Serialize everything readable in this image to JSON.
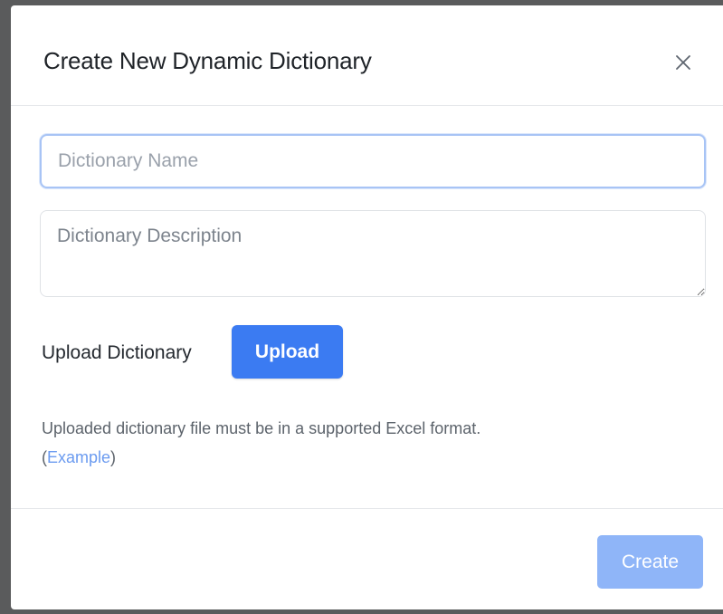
{
  "dialog": {
    "title": "Create New Dynamic Dictionary",
    "close_icon": "close-icon"
  },
  "form": {
    "name_placeholder": "Dictionary Name",
    "name_value": "",
    "description_placeholder": "Dictionary Description",
    "description_value": "",
    "upload_label": "Upload Dictionary",
    "upload_button_label": "Upload",
    "helper_text": "Uploaded dictionary file must be in a supported Excel format.",
    "example_open": "(",
    "example_link_label": "Example",
    "example_close": ")"
  },
  "footer": {
    "create_button_label": "Create",
    "create_button_disabled": true
  },
  "colors": {
    "accent": "#3b7bf2",
    "disabled_accent": "#8fb5f8",
    "link": "#6b9bf0",
    "focus_border": "#a8c4f5",
    "backdrop": "#5a5b5c"
  }
}
